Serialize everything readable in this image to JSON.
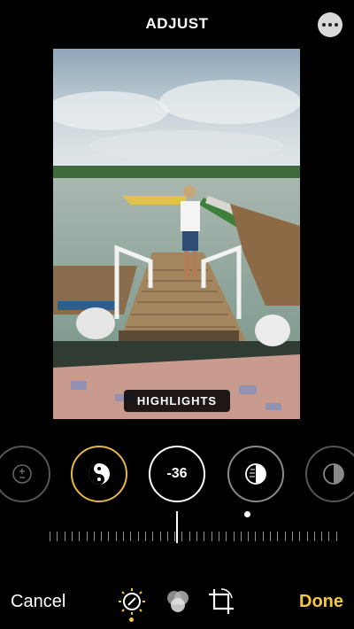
{
  "header": {
    "title": "ADJUST"
  },
  "photo": {
    "mode_label": "HIGHLIGHTS"
  },
  "adjustments": {
    "current_value": "-36",
    "slider_value": -36,
    "items": [
      "exposure",
      "brilliance",
      "highlights",
      "shadows",
      "contrast"
    ]
  },
  "icons": [
    "more-icon",
    "plus-minus-icon",
    "yin-yang-icon",
    "half-circle-icon",
    "adjust-dial-icon",
    "filters-icon",
    "crop-rotate-icon"
  ],
  "bottom": {
    "cancel_label": "Cancel",
    "done_label": "Done"
  },
  "colors": {
    "accent": "#f5c842",
    "active_ring": "#e8b74a",
    "background": "#000000"
  }
}
